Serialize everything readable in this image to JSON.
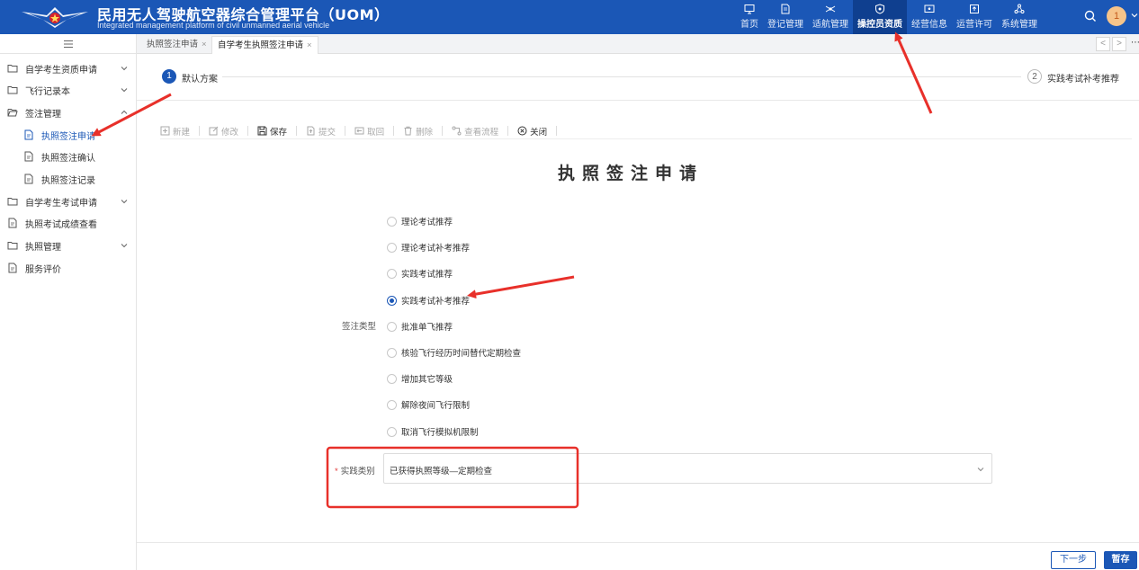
{
  "header": {
    "title": "民用无人驾驶航空器综合管理平台（UOM）",
    "subtitle": "Integrated management platform of civil unmanned aerial vehicle",
    "nav": [
      {
        "label": "首页",
        "icon": "monitor-icon",
        "active": false
      },
      {
        "label": "登记管理",
        "icon": "document-icon",
        "active": false
      },
      {
        "label": "适航管理",
        "icon": "drone-icon",
        "active": false
      },
      {
        "label": "操控员资质",
        "icon": "shield-icon",
        "active": true
      },
      {
        "label": "经营信息",
        "icon": "screen-icon",
        "active": false
      },
      {
        "label": "运营许可",
        "icon": "upload-icon",
        "active": false
      },
      {
        "label": "系统管理",
        "icon": "network-icon",
        "active": false
      }
    ],
    "avatar_label": "1"
  },
  "sidebar": {
    "toggle_icon": "menu-icon",
    "items": [
      {
        "label": "自学考生资质申请",
        "type": "folder",
        "expandable": true
      },
      {
        "label": "飞行记录本",
        "type": "folder",
        "expandable": true
      },
      {
        "label": "签注管理",
        "type": "folder-open",
        "expandable": true
      },
      {
        "label": "执照签注申请",
        "type": "page",
        "sub": true,
        "active": true
      },
      {
        "label": "执照签注确认",
        "type": "page",
        "sub": true
      },
      {
        "label": "执照签注记录",
        "type": "page",
        "sub": true
      },
      {
        "label": "自学考生考试申请",
        "type": "folder",
        "expandable": true
      },
      {
        "label": "执照考试成绩查看",
        "type": "page"
      },
      {
        "label": "执照管理",
        "type": "folder",
        "expandable": true
      },
      {
        "label": "服务评价",
        "type": "page"
      }
    ]
  },
  "tabs": [
    {
      "label": "执照签注申请",
      "active": false
    },
    {
      "label": "自学考生执照签注申请",
      "active": true
    }
  ],
  "tab_close": "×",
  "tab_nav": {
    "prev": "<",
    "next": ">",
    "more": "⋯"
  },
  "steps": [
    {
      "number": "1",
      "label": "默认方案",
      "active": true
    },
    {
      "number": "2",
      "label": "实践考试补考推荐",
      "active": false
    }
  ],
  "toolbar": [
    {
      "label": "新建",
      "icon": "plus-box-icon",
      "enabled": false
    },
    {
      "label": "修改",
      "icon": "edit-icon",
      "enabled": false
    },
    {
      "label": "保存",
      "icon": "save-icon",
      "enabled": true
    },
    {
      "label": "提交",
      "icon": "submit-icon",
      "enabled": false
    },
    {
      "label": "取回",
      "icon": "retrieve-icon",
      "enabled": false
    },
    {
      "label": "删除",
      "icon": "trash-icon",
      "enabled": false
    },
    {
      "label": "查看流程",
      "icon": "flow-icon",
      "enabled": false
    },
    {
      "label": "关闭",
      "icon": "close-circle-icon",
      "enabled": true
    }
  ],
  "form": {
    "title": "执照签注申请",
    "endorsement_type_label": "签注类型",
    "endorsement_options": [
      {
        "label": "理论考试推荐",
        "checked": false
      },
      {
        "label": "理论考试补考推荐",
        "checked": false
      },
      {
        "label": "实践考试推荐",
        "checked": false
      },
      {
        "label": "实践考试补考推荐",
        "checked": true
      },
      {
        "label": "批准单飞推荐",
        "checked": false
      },
      {
        "label": "核验飞行经历时间替代定期检查",
        "checked": false
      },
      {
        "label": "增加其它等级",
        "checked": false
      },
      {
        "label": "解除夜间飞行限制",
        "checked": false
      },
      {
        "label": "取消飞行模拟机限制",
        "checked": false
      }
    ],
    "practice_category_label": "实践类别",
    "required_mark": "*",
    "practice_category_value": "已获得执照等级—定期检查"
  },
  "footer": {
    "next_label": "下一步",
    "save_label": "暂存"
  },
  "colors": {
    "brand": "#1b57b6",
    "annotation": "#e8302a"
  }
}
